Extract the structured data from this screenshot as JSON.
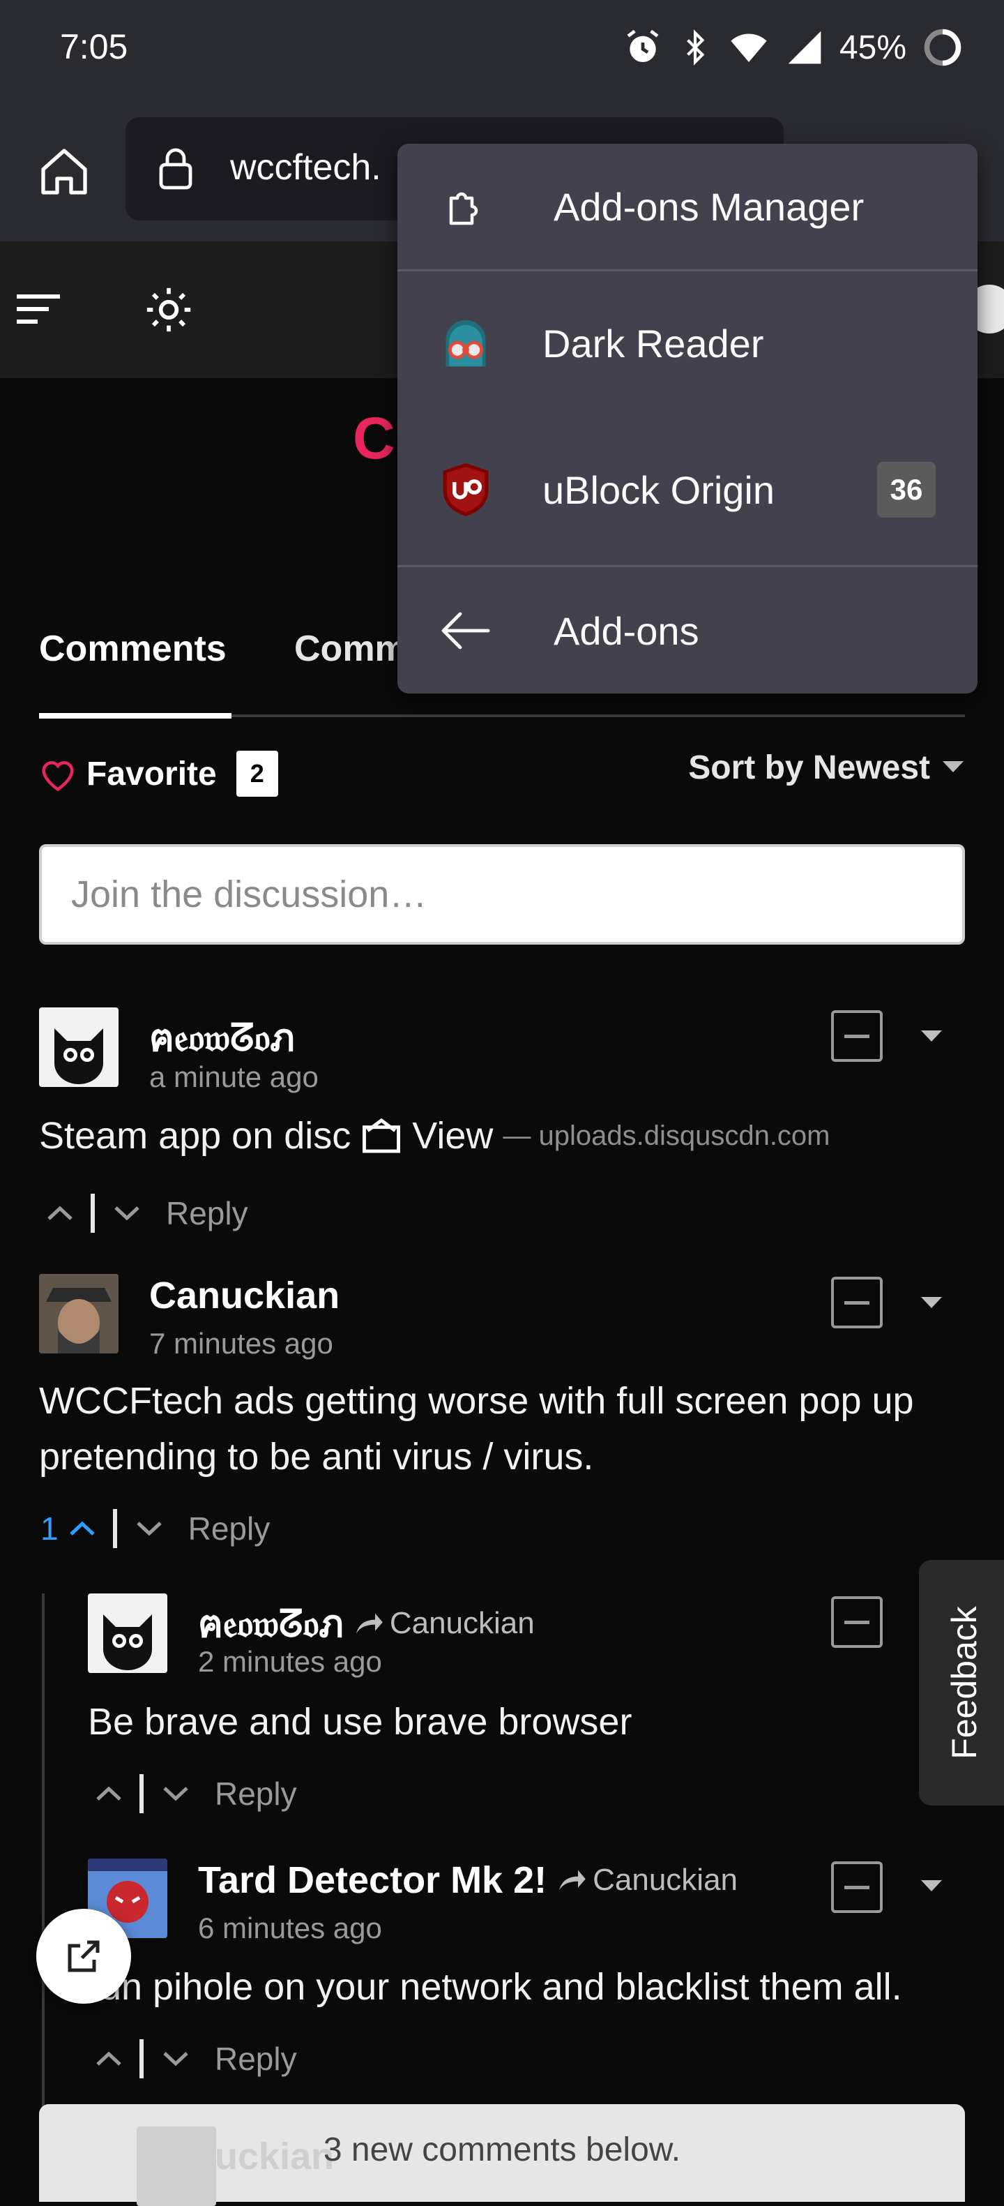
{
  "status_bar": {
    "time": "7:05",
    "battery": "45%"
  },
  "browser": {
    "url": "wccftech.",
    "addons_menu": {
      "items": [
        {
          "label": "Add-ons Manager"
        },
        {
          "label": "Dark Reader"
        },
        {
          "label": "uBlock Origin",
          "badge": "36"
        },
        {
          "label": "Add-ons"
        }
      ]
    }
  },
  "site": {
    "brand_letter": "C"
  },
  "comments_section": {
    "tabs": [
      "Comments",
      "Comm"
    ],
    "favorite_label": "Favorite",
    "favorite_count": "2",
    "sort_label": "Sort by Newest",
    "discussion_placeholder": "Join the discussion…",
    "reply_label": "Reply",
    "comments": [
      {
        "author": "ฅ𝔢𝔬𝔴ᘔ𝔬ภ",
        "time": "a minute ago",
        "body": "Steam app on disc",
        "link_label": "View",
        "link_source": "— uploads.disquscdn.com"
      },
      {
        "author": "Canuckian",
        "time": "7 minutes ago",
        "body": "WCCFtech ads getting worse with full screen pop up pretending to be anti virus / virus.",
        "upvotes": "1"
      },
      {
        "author": "ฅ𝔢𝔬𝔴ᘔ𝔬ภ",
        "reply_to": "Canuckian",
        "time": "2 minutes ago",
        "body": "Be brave and use brave browser"
      },
      {
        "author": "Tard Detector Mk 2!",
        "reply_to": "Canuckian",
        "time": "6 minutes ago",
        "body": "run pihole on your network and blacklist them all."
      }
    ],
    "new_comments_text": "3 new comments below.",
    "ghost_author": "Canuckian"
  },
  "feedback_label": "Feedback"
}
